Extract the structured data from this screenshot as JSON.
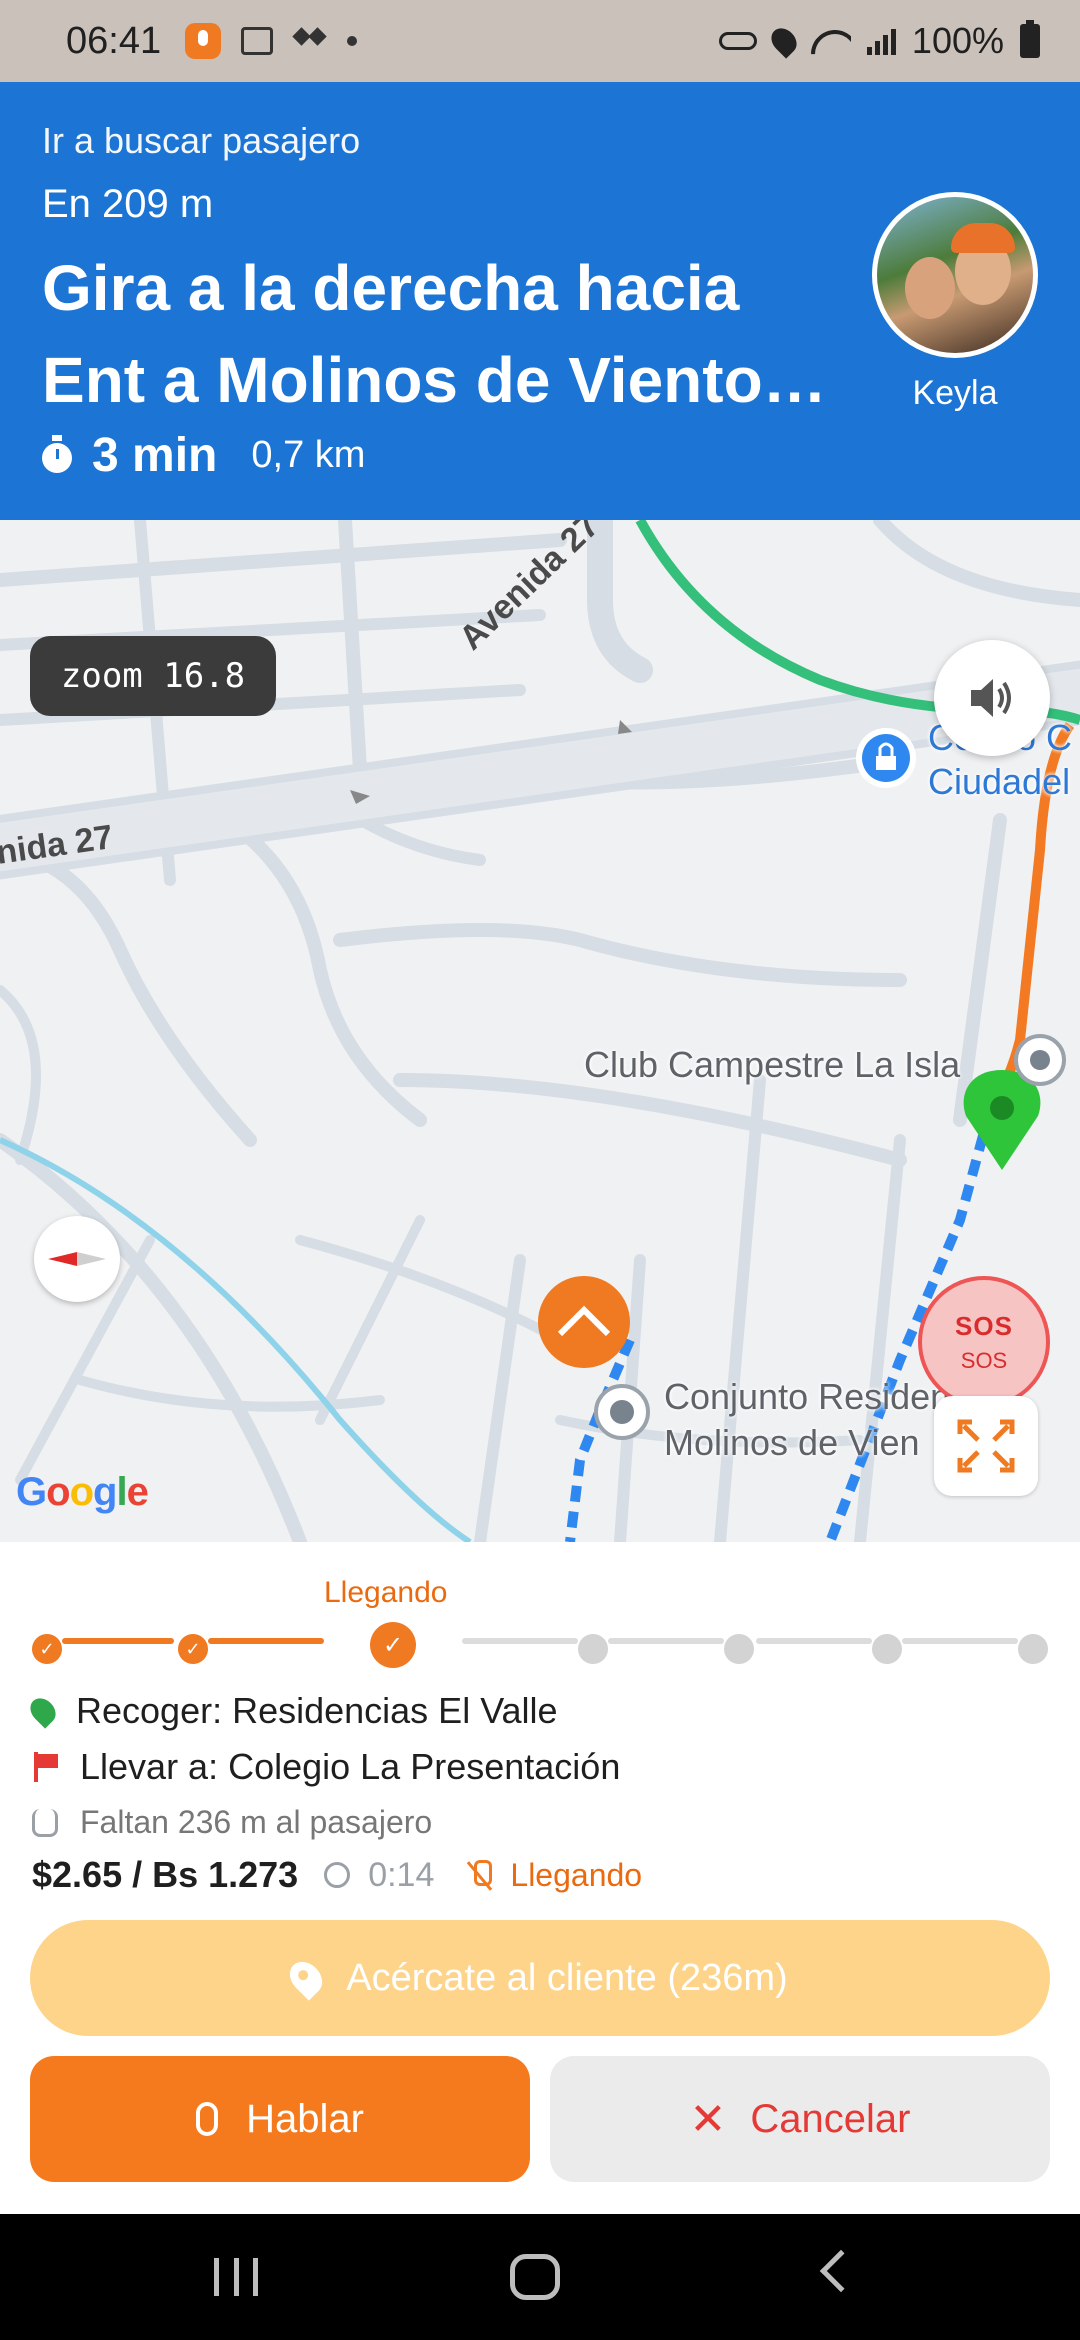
{
  "status_bar": {
    "time": "06:41",
    "battery": "100%",
    "icons": [
      "recorder-icon",
      "screenshot-icon",
      "dropbox-icon",
      "dot-icon",
      "vpn-key-icon",
      "location-icon",
      "wifi-icon",
      "signal-icon",
      "battery-icon"
    ]
  },
  "nav": {
    "subtitle": "Ir a buscar pasajero",
    "distance": "En 209 m",
    "instruction_line1": "Gira a la derecha hacia",
    "instruction_line2": "Ent a Molinos de Viento …",
    "eta_time": "3 min",
    "eta_distance": "0,7 km",
    "passenger_name": "Keyla",
    "header_color": "#1c74d4"
  },
  "map": {
    "zoom_label": "zoom 16.8",
    "road_avenida_27_a": "Avenida 27",
    "road_avenida_27_b": "nida 27",
    "poi_centro_line1": "Centro C",
    "poi_centro_line2": "Ciudadel",
    "poi_club": "Club Campestre La Isla",
    "poi_conjunto_line1": "Conjunto Residencial",
    "poi_conjunto_line2": "Molinos de Vien",
    "sos_main": "SOS",
    "sos_sub": "SOS",
    "google_logo": "Google"
  },
  "trip": {
    "progress_label": "Llegando",
    "steps_total": 8,
    "steps_done": 3,
    "pickup": "Recoger: Residencias El Valle",
    "dropoff": "Llevar a: Colegio La Presentación",
    "remaining": "Faltan 236 m al pasajero",
    "price": "$2.65 / Bs 1.273",
    "elapsed": "0:14",
    "status": "Llegando",
    "accent_color": "#f07a22"
  },
  "actions": {
    "approach_label": "Acércate al cliente (236m)",
    "talk_label": "Hablar",
    "cancel_label": "Cancelar"
  }
}
